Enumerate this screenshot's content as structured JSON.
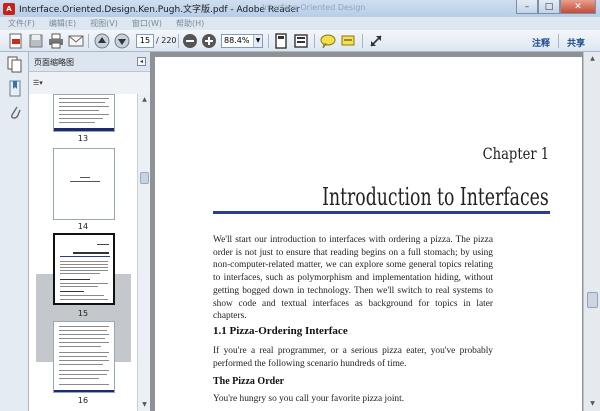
{
  "window": {
    "title": "Interface.Oriented.Design.Ken.Pugh.文字版.pdf - Adobe Reader",
    "ghost_title": "Interface Oriented Design",
    "minimize": "–",
    "maximize": "□",
    "close": "✕"
  },
  "menubar": [
    "文件(F)",
    "编辑(E)",
    "视图(V)",
    "窗口(W)",
    "帮助(H)"
  ],
  "toolbar": {
    "page_current": "15",
    "page_total": "/ 220",
    "zoom": "88.4%",
    "comment_label": "注释",
    "share_label": "共享"
  },
  "sidebar": {
    "panel_title": "页面缩略图",
    "thumbnails": [
      {
        "label": "13"
      },
      {
        "label": "14"
      },
      {
        "label": "15",
        "selected": true
      },
      {
        "label": "16"
      }
    ]
  },
  "document": {
    "chapter_label": "Chapter 1",
    "chapter_title": "Introduction to Interfaces",
    "intro_paragraph": "We'll start our introduction to interfaces with ordering a pizza. The pizza order is not just to ensure that reading begins on a full stomach; by using non-computer-related matter, we can explore some general topics relating to interfaces, such as polymorphism and implementation hiding, without getting bogged down in technology. Then we'll switch to real systems to show code and textual interfaces as background for topics in later chapters.",
    "section_heading": "1.1   Pizza-Ordering Interface",
    "section_paragraph": "If you're a real programmer, or a serious pizza eater, you've probably performed the following scenario hundreds of time.",
    "subsection_heading": "The Pizza Order",
    "subsection_paragraph": "You're hungry so you call your favorite pizza joint."
  },
  "colors": {
    "chapter_rule": "#2b3c96",
    "title_bar": "#b6cde6",
    "doc_background": "#8e9297"
  }
}
